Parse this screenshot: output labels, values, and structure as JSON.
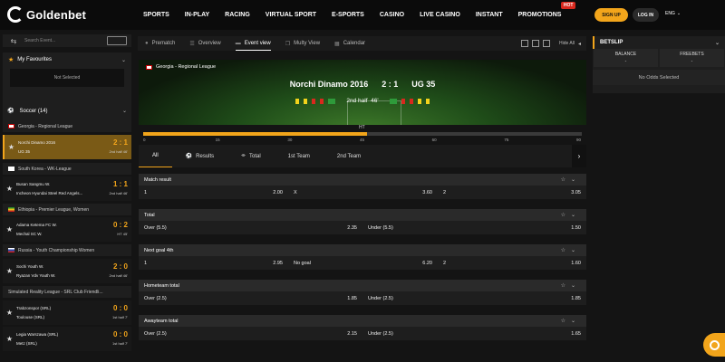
{
  "brand": {
    "name": "Goldenbet"
  },
  "nav": [
    {
      "label": "SPORTS"
    },
    {
      "label": "IN-PLAY"
    },
    {
      "label": "RACING"
    },
    {
      "label": "VIRTUAL SPORT"
    },
    {
      "label": "E-SPORTS"
    },
    {
      "label": "CASINO"
    },
    {
      "label": "LIVE CASINO"
    },
    {
      "label": "INSTANT"
    },
    {
      "label": "PROMOTIONS",
      "badge": "HOT"
    }
  ],
  "header": {
    "signup": "SIGN UP",
    "login": "LOG IN",
    "lang": "ENG"
  },
  "sidebar": {
    "search_placeholder": "Search Event...",
    "favourites_title": "My Favourites",
    "favourites_empty": "Not Selected",
    "sport": "Soccer",
    "sport_count": "(14)",
    "leagues": [
      {
        "name": "Georgia - Regional League",
        "matches": [
          {
            "home": "Norchi Dinamo 2016",
            "away": "UG 35",
            "score": "2 : 1",
            "time": "2nd half  46'",
            "active": true
          }
        ]
      },
      {
        "name": "South Korea - WK-League",
        "matches": [
          {
            "home": "Busan Sangmu W.",
            "away": "Incheon Hyundai Steel Red Angels...",
            "score": "1 : 1",
            "time": "2nd half  46'",
            "active": false
          }
        ]
      },
      {
        "name": "Ethiopia - Premier League, Women",
        "matches": [
          {
            "home": "Adama Ketema FC W.",
            "away": "Mechal SC W.",
            "score": "0 : 2",
            "time": "HT  45'",
            "active": false
          }
        ]
      },
      {
        "name": "Russia - Youth Championship Women",
        "matches": [
          {
            "home": "Sochi Youth W.",
            "away": "Ryazan Vdv Youth W.",
            "score": "2 : 0",
            "time": "2nd half  46'",
            "active": false
          }
        ]
      },
      {
        "name": "Simulated Reality League - SRL Club Friendli...",
        "matches": [
          {
            "home": "Trabzonspor (SRL)",
            "away": "Toulouse (SRL)",
            "score": "0 : 0",
            "time": "1st half  7'",
            "active": false
          },
          {
            "home": "Legia Warszawa (SRL)",
            "away": "Metz (SRL)",
            "score": "0 : 0",
            "time": "1st half  7'",
            "active": false
          }
        ]
      }
    ]
  },
  "view_tabs": [
    {
      "label": "Prematch"
    },
    {
      "label": "Overview"
    },
    {
      "label": "Event view",
      "active": true
    },
    {
      "label": "Multy View"
    },
    {
      "label": "Calendar"
    }
  ],
  "hide_all": "Hide All",
  "event": {
    "league": "Georgia - Regional League",
    "home": "Norchi Dinamo 2016",
    "away": "UG 35",
    "score": "2 : 1",
    "period": "2nd half",
    "minute": "46'",
    "ht_label": "HT",
    "progress_fraction": 0.51,
    "ticks": [
      "0",
      "15",
      "30",
      "45",
      "60",
      "75",
      "90"
    ]
  },
  "market_tabs": [
    {
      "label": "All",
      "active": true
    },
    {
      "label": "Results"
    },
    {
      "label": "Total"
    },
    {
      "label": "1st Team"
    },
    {
      "label": "2nd Team"
    }
  ],
  "markets": [
    {
      "title": "Match result",
      "cells": [
        {
          "l": "1",
          "v": "2.00"
        },
        {
          "l": "X",
          "v": "3.60"
        },
        {
          "l": "2",
          "v": "3.05"
        }
      ]
    },
    {
      "title": "Total",
      "cells": [
        {
          "l": "Over (5.5)",
          "v": "2.35"
        },
        {
          "l": "Under (5.5)",
          "v": "1.50"
        }
      ]
    },
    {
      "title": "Next goal 4th",
      "cells": [
        {
          "l": "1",
          "v": "2.95"
        },
        {
          "l": "No goal",
          "v": "6.20"
        },
        {
          "l": "2",
          "v": "1.60"
        }
      ]
    },
    {
      "title": "Hometeam total",
      "cells": [
        {
          "l": "Over (2.5)",
          "v": "1.85"
        },
        {
          "l": "Under (2.5)",
          "v": "1.85"
        }
      ]
    },
    {
      "title": "Awayteam total",
      "cells": [
        {
          "l": "Over (2.5)",
          "v": "2.15"
        },
        {
          "l": "Under (2.5)",
          "v": "1.65"
        }
      ]
    }
  ],
  "betslip": {
    "title": "BETSLIP",
    "balance_label": "BALANCE",
    "balance_value": "-",
    "freebets_label": "FREEBETS",
    "freebets_value": "-",
    "empty": "No Odds Selected"
  },
  "colors": {
    "accent": "#f2a51b",
    "hot": "#d9281d"
  }
}
